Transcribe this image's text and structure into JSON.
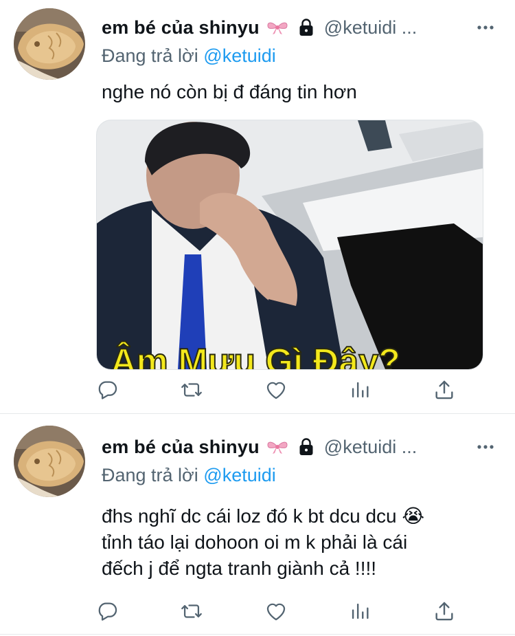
{
  "tweets": [
    {
      "display_name": "em bé của shinyu",
      "handle": "@ketuidi ...",
      "reply_prefix": "Đang trả lời",
      "reply_to": "@ketuidi",
      "text": "nghe nó còn bị đ đáng tin hơn",
      "media_caption": "Âm Mưu Gì Đây?"
    },
    {
      "display_name": "em bé của shinyu",
      "handle": "@ketuidi ...",
      "reply_prefix": "Đang trả lời",
      "reply_to": "@ketuidi",
      "text_lines": [
        "đhs nghĩ dc cái loz đó k bt dcu dcu 😭",
        "tỉnh táo lại dohoon oi m k phải là cái",
        "đếch j để ngta tranh giành cả !!!!"
      ]
    }
  ],
  "icons": {
    "reply": "reply-icon",
    "retweet": "retweet-icon",
    "like": "heart-icon",
    "analytics": "analytics-icon",
    "share": "share-icon",
    "more": "more-icon",
    "lock": "lock-icon",
    "bow": "ribbon-bow-emoji"
  },
  "colors": {
    "text": "#0f1419",
    "secondary": "#536471",
    "link": "#1d9bf0",
    "divider": "#e6e9eb"
  }
}
